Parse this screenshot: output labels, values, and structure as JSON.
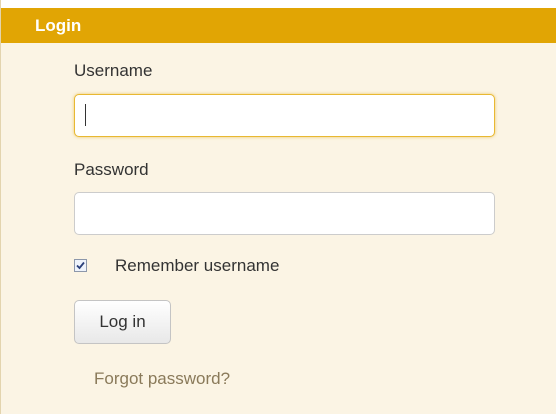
{
  "panel": {
    "title": "Login"
  },
  "form": {
    "username_label": "Username",
    "username_value": "",
    "password_label": "Password",
    "password_value": "",
    "remember_label": "Remember username",
    "remember_checked": true,
    "submit_label": "Log in",
    "forgot_label": "Forgot password?"
  },
  "colors": {
    "header_bg": "#e1a504",
    "panel_bg": "#fbf4e4",
    "focus_border": "#e8b832",
    "link": "#8a7a5a"
  }
}
